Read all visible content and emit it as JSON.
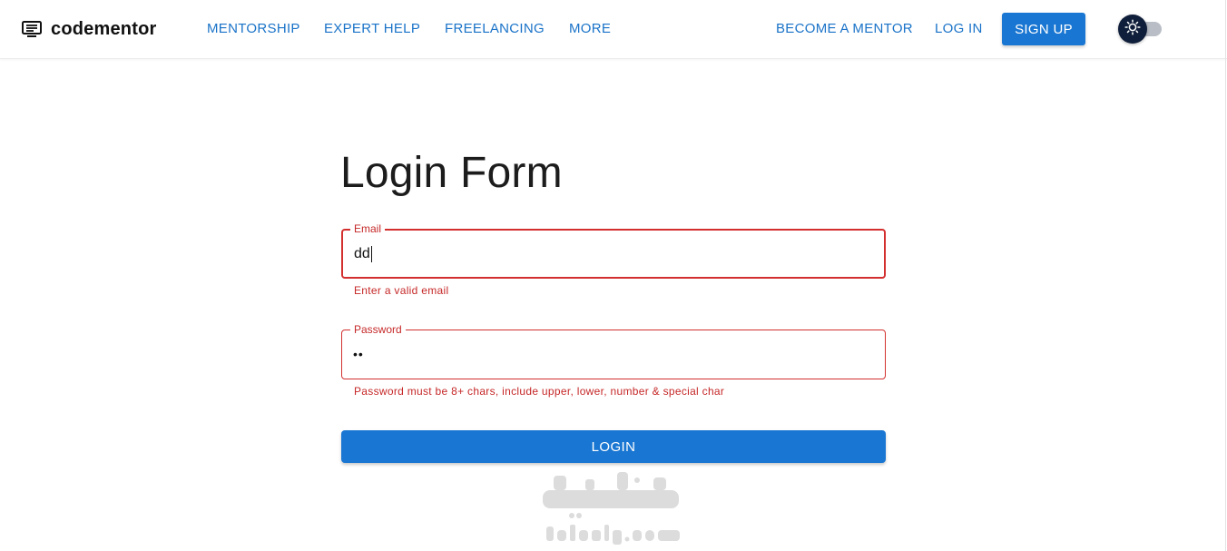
{
  "header": {
    "brand": "codementor",
    "brand_icon": "monitor-icon",
    "nav": [
      "MENTORSHIP",
      "EXPERT HELP",
      "FREELANCING",
      "MORE"
    ],
    "become_mentor": "BECOME A MENTOR",
    "login": "LOG IN",
    "signup": "SIGN UP",
    "theme_toggle_icon": "sun-icon"
  },
  "form": {
    "title": "Login Form",
    "email": {
      "label": "Email",
      "value": "dd",
      "error": "Enter a valid email"
    },
    "password": {
      "label": "Password",
      "value": "••",
      "error": "Password must be 8+ chars, include upper, lower, number & special char"
    },
    "submit": "LOGIN"
  },
  "watermark": {
    "arabic": "نفذلي",
    "latin": "nafezly.com"
  },
  "colors": {
    "primary": "#1976d2",
    "link": "#1a73c8",
    "error": "#c62828",
    "toggle_thumb": "#0f1e3a"
  }
}
